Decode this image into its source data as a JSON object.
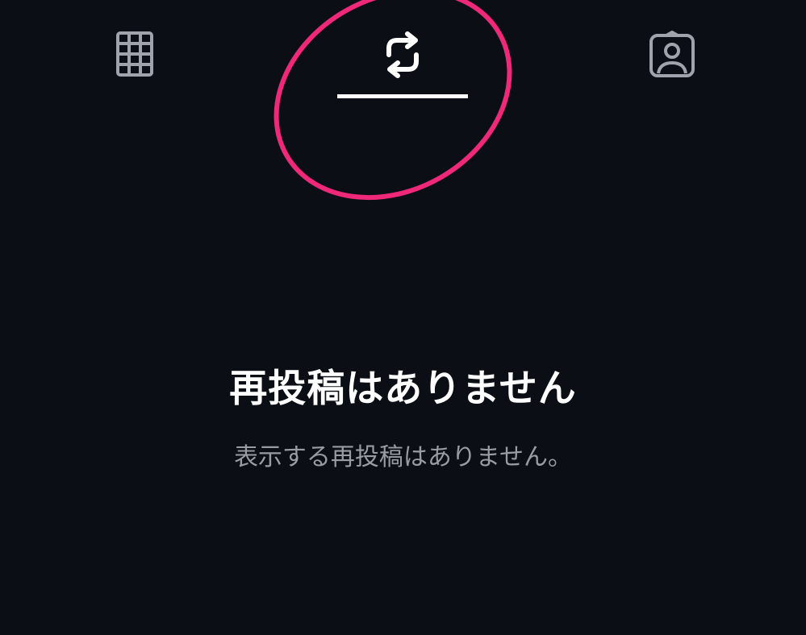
{
  "tabs": [
    {
      "id": "posts",
      "icon": "grid-icon",
      "active": false
    },
    {
      "id": "reposts",
      "icon": "repost-icon",
      "active": true
    },
    {
      "id": "tagged",
      "icon": "tagged-person-icon",
      "active": false
    }
  ],
  "empty_state": {
    "title": "再投稿はありません",
    "subtitle": "表示する再投稿はありません。"
  },
  "colors": {
    "background": "#0b0e14",
    "active_icon": "#ffffff",
    "inactive_icon": "#a0a3ab",
    "indicator": "#ffffff",
    "annotation_circle": "#f0287a",
    "subtitle_text": "#9a9ca4"
  }
}
